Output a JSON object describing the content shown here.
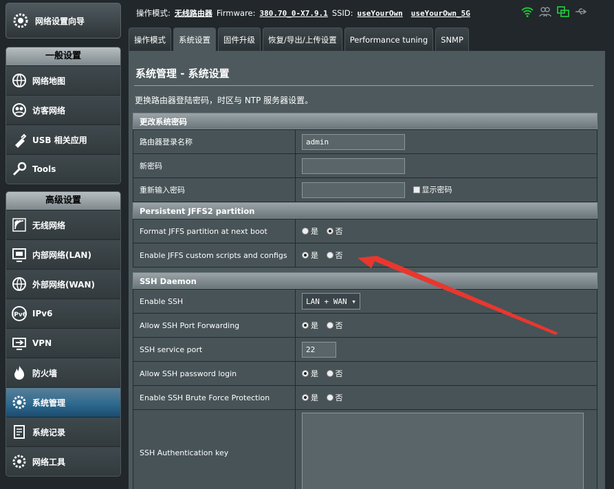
{
  "sidebar": {
    "wizard_label": "网络设置向导",
    "general_header": "一般设置",
    "general_items": [
      {
        "label": "网络地图",
        "icon": "globe-icon"
      },
      {
        "label": "访客网络",
        "icon": "guest-network-icon"
      },
      {
        "label": "USB 相关应用",
        "icon": "usb-icon"
      },
      {
        "label": "Tools",
        "icon": "wrench-icon"
      }
    ],
    "advanced_header": "高级设置",
    "advanced_items": [
      {
        "label": "无线网络",
        "icon": "wireless-icon"
      },
      {
        "label": "内部网络(LAN)",
        "icon": "lan-icon"
      },
      {
        "label": "外部网络(WAN)",
        "icon": "wan-globe-icon"
      },
      {
        "label": "IPv6",
        "icon": "ipv6-icon"
      },
      {
        "label": "VPN",
        "icon": "vpn-icon"
      },
      {
        "label": "防火墙",
        "icon": "firewall-icon"
      },
      {
        "label": "系统管理",
        "icon": "admin-gear-icon",
        "active": true
      },
      {
        "label": "系统记录",
        "icon": "log-icon"
      },
      {
        "label": "网络工具",
        "icon": "network-tools-icon"
      }
    ]
  },
  "topbar": {
    "mode_key": "操作模式:",
    "mode_value": "无线路由器",
    "fw_key": "Firmware:",
    "fw_value": "380.70_0-X7.9.1",
    "ssid_key": "SSID:",
    "ssid_1": "useYourOwn",
    "ssid_2": "useYourOwn_5G"
  },
  "tabs": [
    "操作模式",
    "系统设置",
    "固件升级",
    "恢复/导出/上传设置",
    "Performance tuning",
    "SNMP"
  ],
  "active_tab": 1,
  "page": {
    "title": "系统管理 - 系统设置",
    "description": "更换路由器登陆密码，时区与 NTP 服务器设置。"
  },
  "password_section": {
    "header": "更改系统密码",
    "login_name_label": "路由器登录名称",
    "login_name_value": "admin",
    "new_password_label": "新密码",
    "retype_password_label": "重新输入密码",
    "show_password_label": "显示密码"
  },
  "jffs_section": {
    "header": "Persistent JFFS2 partition",
    "format_label": "Format JFFS partition at next boot",
    "scripts_label": "Enable JFFS custom scripts and configs",
    "yes": "是",
    "no": "否"
  },
  "ssh_section": {
    "header": "SSH Daemon",
    "enable_label": "Enable SSH",
    "enable_value": "LAN + WAN",
    "forwarding_label": "Allow SSH Port Forwarding",
    "port_label": "SSH service port",
    "port_value": "22",
    "password_login_label": "Allow SSH password login",
    "brute_label": "Enable SSH Brute Force Protection",
    "auth_key_label": "SSH Authentication key",
    "yes": "是",
    "no": "否"
  },
  "colors": {
    "annotation_arrow": "#e8372f",
    "active_menu": "#2e6a8f",
    "wifi_status": "#21c23a"
  }
}
